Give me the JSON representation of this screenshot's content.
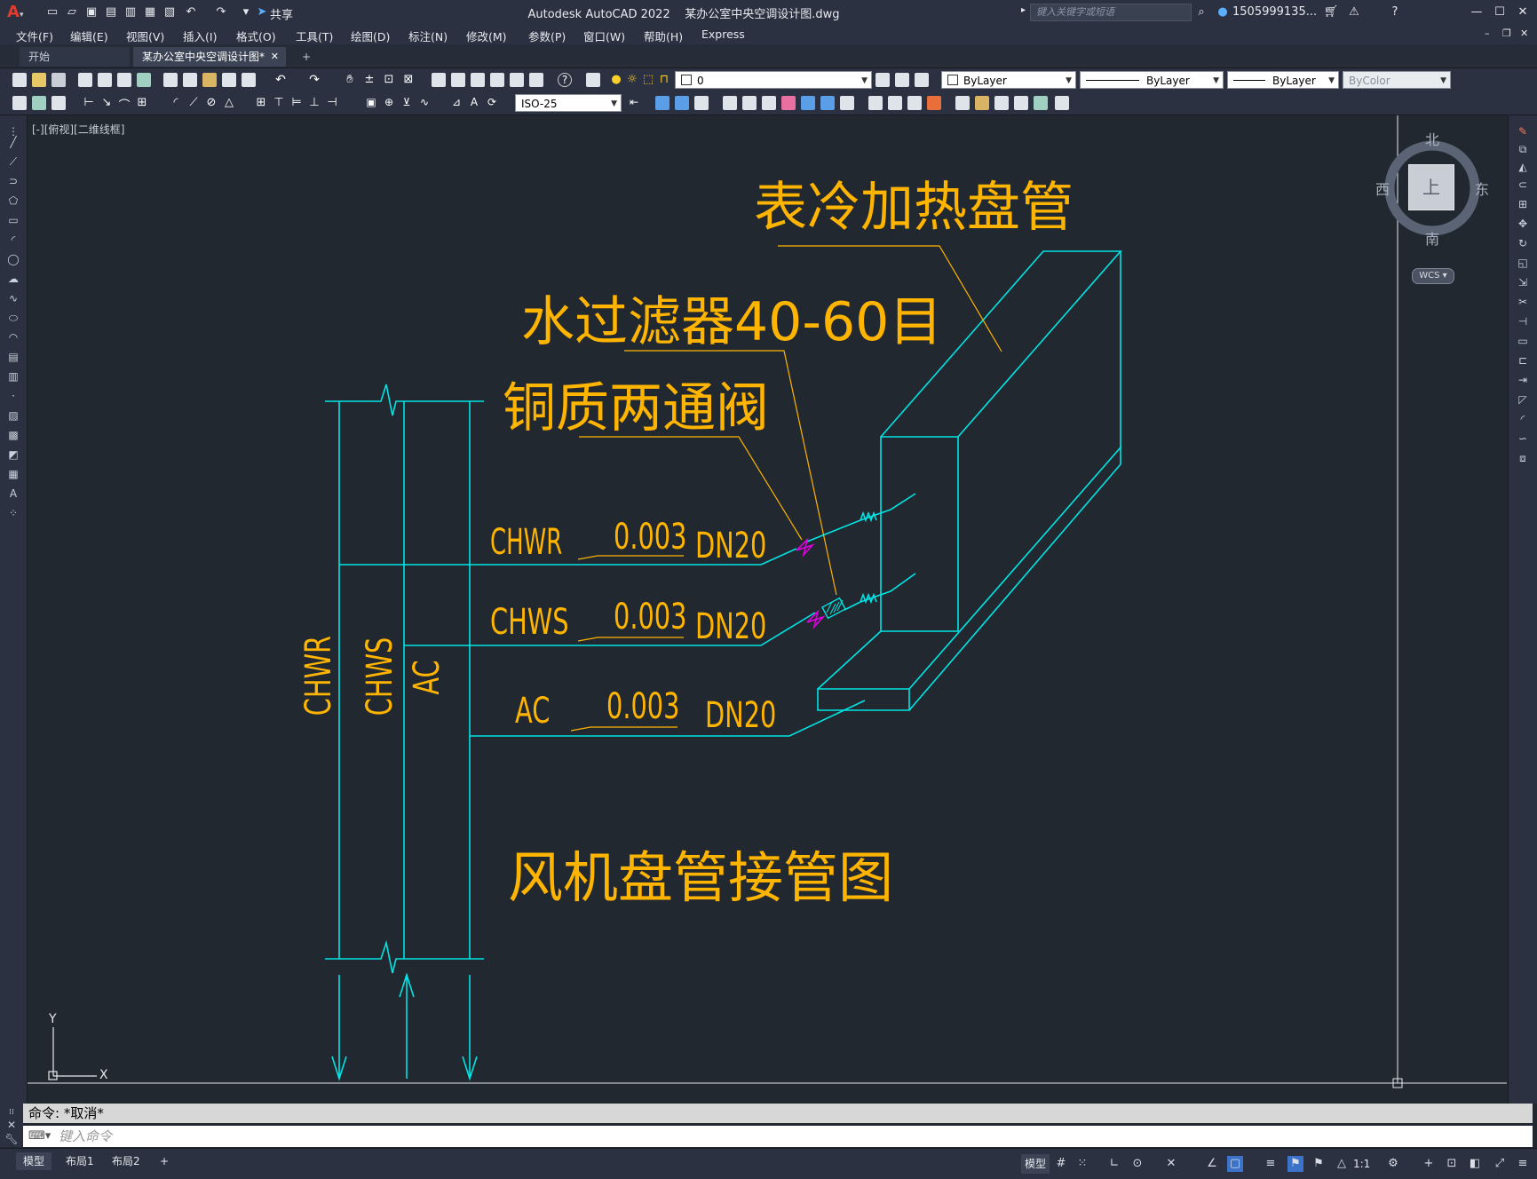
{
  "titlebar": {
    "app_title": "Autodesk AutoCAD 2022",
    "file_name": "某办公室中央空调设计图.dwg",
    "share_label": "共享",
    "search_placeholder": "键入关键字或短语",
    "user_name": "1505999135..."
  },
  "menu": {
    "items": [
      "文件(F)",
      "编辑(E)",
      "视图(V)",
      "插入(I)",
      "格式(O)",
      "工具(T)",
      "绘图(D)",
      "标注(N)",
      "修改(M)",
      "参数(P)",
      "窗口(W)",
      "帮助(H)",
      "Express"
    ]
  },
  "tabs": {
    "start": "开始",
    "active_drawing": "某办公室中央空调设计图*",
    "add": "+"
  },
  "toolbar": {
    "layer_value": "0",
    "color_value": "ByLayer",
    "linetype_value": "ByLayer",
    "lineweight_value": "ByLayer",
    "plotstyle_value": "ByColor",
    "dimstyle_value": "ISO-25"
  },
  "viewport": {
    "view_label": "[-][俯视][二维线框]"
  },
  "viewcube": {
    "north": "北",
    "south": "南",
    "east": "东",
    "west": "西",
    "face": "上",
    "wcs": "WCS"
  },
  "drawing": {
    "label_coil": "表冷加热盘管",
    "label_filter": "水过滤器40-60目",
    "label_valve": "铜质两通阀",
    "title": "风机盘管接管图",
    "pipe_rows": [
      {
        "name": "CHWR",
        "slope": "0.003",
        "size": "DN20"
      },
      {
        "name": "CHWS",
        "slope": "0.003",
        "size": "DN20"
      },
      {
        "name": "AC",
        "slope": "0.003",
        "size": "DN20"
      }
    ],
    "riser_labels": [
      "CHWR",
      "CHWS",
      "AC"
    ],
    "ucs_x": "X",
    "ucs_y": "Y"
  },
  "command": {
    "history": "命令:  *取消*",
    "input_placeholder": "键入命令"
  },
  "layouts": {
    "model": "模型",
    "layout1": "布局1",
    "layout2": "布局2",
    "add": "+"
  },
  "status": {
    "model_label": "模型",
    "scale": "1:1"
  },
  "colors": {
    "drawing_line": "#00e5e5",
    "drawing_text": "#ffb400",
    "valve_magenta": "#e000e0"
  }
}
